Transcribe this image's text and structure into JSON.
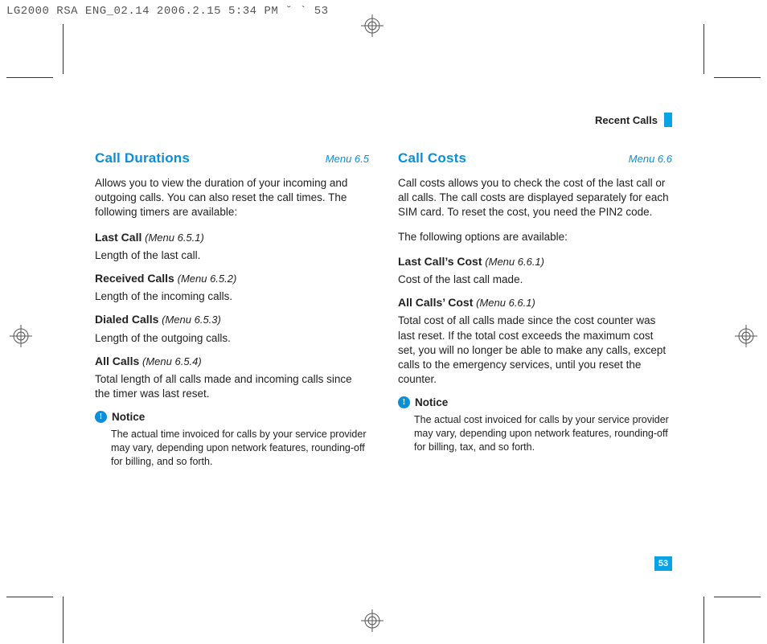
{
  "meta_top": "LG2000 RSA ENG_02.14  2006.2.15 5:34 PM  ˘    ` 53",
  "header": {
    "title": "Recent Calls"
  },
  "page_number": "53",
  "left": {
    "title": "Call Durations",
    "menu": "Menu 6.5",
    "intro": "Allows you to view the duration of your incoming and outgoing calls. You can also reset the call times. The following timers are available:",
    "items": [
      {
        "title": "Last Call",
        "ref": "(Menu 6.5.1)",
        "body": "Length of the last call."
      },
      {
        "title": "Received Calls",
        "ref": "(Menu 6.5.2)",
        "body": "Length of the incoming calls."
      },
      {
        "title": "Dialed Calls",
        "ref": "(Menu 6.5.3)",
        "body": "Length of the outgoing calls."
      },
      {
        "title": "All Calls",
        "ref": "(Menu 6.5.4)",
        "body": "Total length of all calls made and incoming calls since the timer was last reset."
      }
    ],
    "notice_label": "Notice",
    "notice_text": "The actual time invoiced for calls by your service provider may vary, depending upon network features, rounding-off for billing, and so forth."
  },
  "right": {
    "title": "Call Costs",
    "menu": "Menu 6.6",
    "intro1": "Call costs allows you to check the cost of the last call or all calls. The call costs are displayed separately for each SIM card. To reset the cost, you need the PIN2 code.",
    "intro2": "The following options are available:",
    "items": [
      {
        "title": "Last Call’s Cost",
        "ref": "(Menu 6.6.1)",
        "body": "Cost of the last call made."
      },
      {
        "title": "All Calls’ Cost",
        "ref": "(Menu 6.6.1)",
        "body": "Total cost of all calls made since the cost counter was last reset. If the total cost exceeds the maximum cost set, you will no longer be able to make any calls, except calls to the emergency services, until you reset the counter."
      }
    ],
    "notice_label": "Notice",
    "notice_text": "The actual cost invoiced for calls by your service provider may vary, depending upon network features, rounding-off for billing, tax, and so forth."
  }
}
